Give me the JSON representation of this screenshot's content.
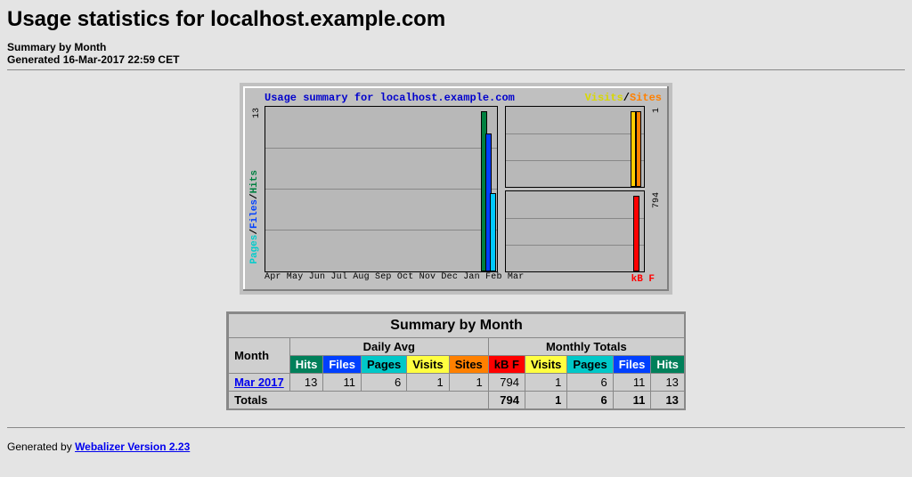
{
  "page": {
    "title": "Usage statistics for localhost.example.com",
    "summary_label": "Summary by Month",
    "generated_label": "Generated 16-Mar-2017 22:59 CET"
  },
  "chart": {
    "title": "Usage summary for localhost.example.com",
    "visits_label": "Visits",
    "sites_label": "Sites",
    "left_ylabel_pages": "Pages",
    "left_ylabel_files": "Files",
    "left_ylabel_hits": "Hits",
    "left_ytick": "13",
    "right_top_tick": "1",
    "right_bottom_tick": "794",
    "right_bottom_label": "kB F",
    "xaxis": "Apr May Jun Jul Aug Sep Oct Nov Dec Jan Feb Mar"
  },
  "table": {
    "title": "Summary by Month",
    "month_label": "Month",
    "daily_avg_label": "Daily Avg",
    "monthly_totals_label": "Monthly Totals",
    "cols": {
      "hits": "Hits",
      "files": "Files",
      "pages": "Pages",
      "visits": "Visits",
      "sites": "Sites",
      "kbf": "kB F"
    },
    "rows": [
      {
        "month": "Mar 2017",
        "daily": {
          "hits": "13",
          "files": "11",
          "pages": "6",
          "visits": "1",
          "sites": "1"
        },
        "monthly": {
          "kbf": "794",
          "visits": "1",
          "pages": "6",
          "files": "11",
          "hits": "13"
        }
      }
    ],
    "totals_label": "Totals",
    "totals": {
      "kbf": "794",
      "visits": "1",
      "pages": "6",
      "files": "11",
      "hits": "13"
    }
  },
  "footer": {
    "generated_by": "Generated by ",
    "link_text": "Webalizer Version 2.23"
  },
  "chart_data": [
    {
      "type": "bar",
      "title": "Usage summary for localhost.example.com",
      "xlabel": "",
      "ylabel": "Pages/Files/Hits",
      "ylim": [
        0,
        13
      ],
      "categories": [
        "Apr",
        "May",
        "Jun",
        "Jul",
        "Aug",
        "Sep",
        "Oct",
        "Nov",
        "Dec",
        "Jan",
        "Feb",
        "Mar"
      ],
      "series": [
        {
          "name": "Hits",
          "values": [
            0,
            0,
            0,
            0,
            0,
            0,
            0,
            0,
            0,
            0,
            0,
            13
          ]
        },
        {
          "name": "Files",
          "values": [
            0,
            0,
            0,
            0,
            0,
            0,
            0,
            0,
            0,
            0,
            0,
            11
          ]
        },
        {
          "name": "Pages",
          "values": [
            0,
            0,
            0,
            0,
            0,
            0,
            0,
            0,
            0,
            0,
            0,
            6
          ]
        }
      ]
    },
    {
      "type": "bar",
      "title": "Visits/Sites",
      "ylim": [
        0,
        1
      ],
      "categories": [
        "Apr",
        "May",
        "Jun",
        "Jul",
        "Aug",
        "Sep",
        "Oct",
        "Nov",
        "Dec",
        "Jan",
        "Feb",
        "Mar"
      ],
      "series": [
        {
          "name": "Visits",
          "values": [
            0,
            0,
            0,
            0,
            0,
            0,
            0,
            0,
            0,
            0,
            0,
            1
          ]
        },
        {
          "name": "Sites",
          "values": [
            0,
            0,
            0,
            0,
            0,
            0,
            0,
            0,
            0,
            0,
            0,
            1
          ]
        }
      ]
    },
    {
      "type": "bar",
      "title": "kB F",
      "ylim": [
        0,
        794
      ],
      "categories": [
        "Apr",
        "May",
        "Jun",
        "Jul",
        "Aug",
        "Sep",
        "Oct",
        "Nov",
        "Dec",
        "Jan",
        "Feb",
        "Mar"
      ],
      "series": [
        {
          "name": "kB F",
          "values": [
            0,
            0,
            0,
            0,
            0,
            0,
            0,
            0,
            0,
            0,
            0,
            794
          ]
        }
      ]
    }
  ]
}
